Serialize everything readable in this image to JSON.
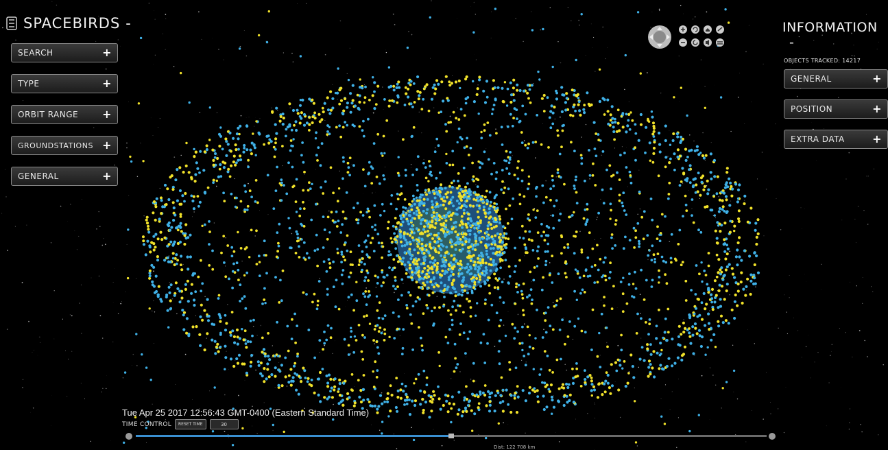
{
  "app": {
    "title": "SPACEBIRDS"
  },
  "left_menu": [
    {
      "label": "SEARCH"
    },
    {
      "label": "TYPE"
    },
    {
      "label": "ORBIT RANGE"
    },
    {
      "label": "GROUNDSTATIONS"
    },
    {
      "label": "GENERAL"
    }
  ],
  "info_panel": {
    "title": "INFORMATION",
    "objects_tracked": "OBJECTS TRACKED: 14217",
    "sections": [
      {
        "label": "GENERAL"
      },
      {
        "label": "POSITION"
      },
      {
        "label": "EXTRA DATA"
      }
    ]
  },
  "time": {
    "datetime": "Tue Apr 25 2017 12:56:43 GMT-0400 (Eastern Standard Time)",
    "control_label": "TIME CONTROL",
    "reset_label": "RESET TIME",
    "speed_value": "30",
    "progress": 0.5
  },
  "distance": "Dist: 122 708 km",
  "icons": {
    "plus": "+",
    "collapse": "-",
    "nav": [
      "pan-icon",
      "zoom-in-icon",
      "rotate-left-icon",
      "home-icon",
      "tool-icon",
      "zoom-out-icon",
      "rotate-right-icon",
      "audio-icon",
      "layers-icon"
    ]
  },
  "colors": {
    "satellite_blue": "#3fb0e6",
    "satellite_yellow": "#f0e12a",
    "earth": "#1e4f7a"
  }
}
